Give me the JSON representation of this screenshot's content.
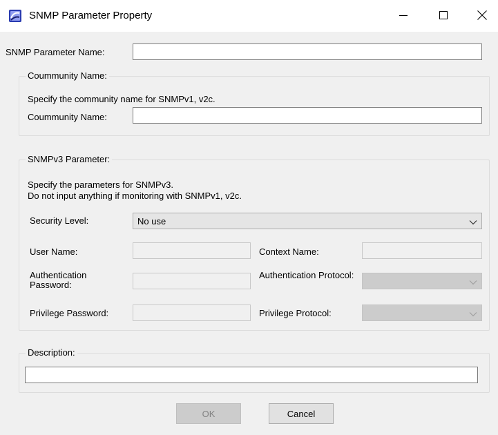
{
  "window": {
    "title": "SNMP Parameter Property",
    "minimize_symbol": "—",
    "maximize_symbol": "☐",
    "close_symbol": "✕"
  },
  "form": {
    "snmp_name_label": "SNMP Parameter Name:",
    "snmp_name_value": "",
    "community_group": {
      "title": "Coummunity Name:",
      "hint": "Specify the community name for SNMPv1, v2c.",
      "label": "Coummunity Name:",
      "value": ""
    },
    "v3_group": {
      "title": "SNMPv3 Parameter:",
      "hint_line1": "Specify the parameters for SNMPv3.",
      "hint_line2": "Do not input anything if monitoring with SNMPv1, v2c.",
      "security_level_label": "Security Level:",
      "security_level_value": "No use",
      "user_name_label": "User Name:",
      "context_name_label": "Context Name:",
      "auth_password_label": "Authentication Password:",
      "auth_protocol_label": "Authentication Protocol:",
      "privilege_password_label": "Privilege Password:",
      "privilege_protocol_label": "Privilege Protocol:"
    },
    "description_group": {
      "title": "Description:",
      "value": ""
    }
  },
  "buttons": {
    "ok": "OK",
    "cancel": "Cancel"
  },
  "icons": {
    "app": "snmp-app-icon",
    "dropdown": "chevron-down-icon"
  }
}
